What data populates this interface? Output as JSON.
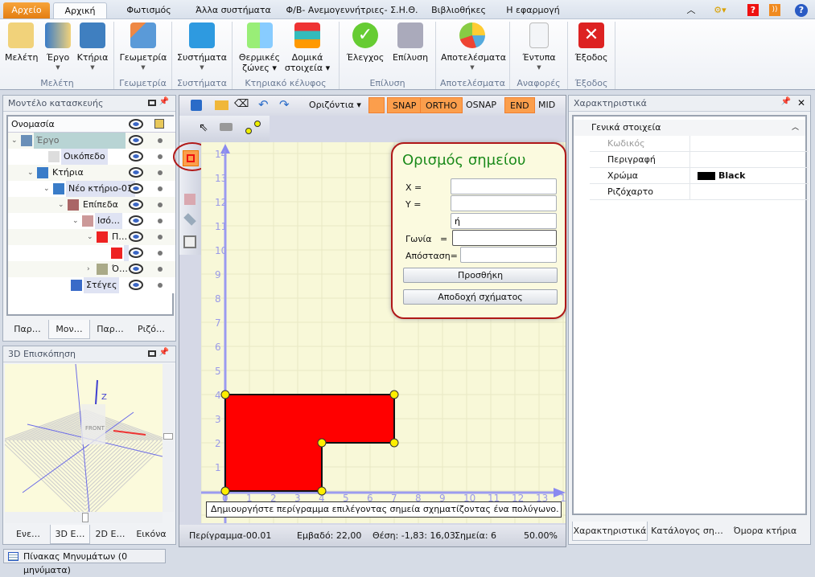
{
  "ribbon_tabs": [
    "Αρχείο",
    "Αρχική",
    "Φωτισμός",
    "Άλλα συστήματα",
    "Φ/Β- Ανεμογεννήτριες- Σ.Η.Θ.",
    "Βιβλιοθήκες",
    "Η εφαρμογή"
  ],
  "ribbon": {
    "buttons": [
      "Μελέτη",
      "Έργο",
      "Κτήρια",
      "Γεωμετρία",
      "Συστήματα",
      "Θερμικές",
      "ζώνες",
      "Δομικά",
      "στοιχεία",
      "Έλεγχος",
      "Επίλυση",
      "Αποτελέσματα",
      "Έντυπα",
      "Έξοδος"
    ],
    "groups": [
      "Μελέτη",
      "Γεωμετρία",
      "Συστήματα",
      "Κτηριακό κέλυφος",
      "Επίλυση",
      "Αποτελέσματα",
      "Αναφορές",
      "Έξοδος"
    ]
  },
  "model_panel": {
    "title": "Μοντέλο κατασκευής",
    "header": "Ονομασία",
    "items": [
      "Έργο",
      "Οικόπεδο",
      "Κτήρια",
      "Νέο κτήριο-01",
      "Επίπεδα",
      "Ισό…",
      "Π…",
      "",
      "Ό…",
      "Στέγες"
    ],
    "tabs": [
      "Παρ…",
      "Μον…",
      "Παρ…",
      "Ριζό…"
    ]
  },
  "preview_panel": {
    "title": "3D Επισκόπηση",
    "axis_label": "Z",
    "cube_label": "FRONT",
    "tabs": [
      "Ενε…",
      "3D Ε…",
      "2D Ε…",
      "Εικόνα"
    ]
  },
  "toolbar": {
    "view_select": "Οριζόντια",
    "snap": "SNAP",
    "ortho": "ORTHO",
    "osnap": "OSNAP",
    "end": "END",
    "mid": "MID"
  },
  "point_form": {
    "title": "Ορισμός σημείου",
    "x_label": "X =",
    "y_label": "Y =",
    "or_value": "ή",
    "angle_label": "Γωνία   =",
    "distance_label": "Απόσταση=",
    "add_button": "Προσθήκη",
    "accept_button": "Αποδοχή σχήματος"
  },
  "canvas": {
    "hint": "Δημιουργήστε περίγραμμα επιλέγοντας σημεία σχηματίζοντας ένα πολύγωνο. Επιλέξτε το",
    "x_ticks": [
      "1",
      "0",
      "1",
      "2",
      "3",
      "4",
      "5",
      "6",
      "7",
      "8",
      "9",
      "10",
      "11",
      "12",
      "13",
      "14"
    ],
    "y_ticks": [
      "1",
      "2",
      "3",
      "4",
      "5",
      "6",
      "7",
      "8",
      "9",
      "10",
      "11",
      "12",
      "13",
      "14"
    ],
    "polygon": [
      [
        0,
        0
      ],
      [
        0,
        4
      ],
      [
        7,
        4
      ],
      [
        7,
        2
      ],
      [
        4,
        2
      ],
      [
        4,
        0
      ]
    ],
    "fill_color": "#ff0000",
    "grid_color": "#f8f8d8"
  },
  "status": {
    "name": "Περίγραμμα-00.01",
    "area": "Εμβαδό: 22,00",
    "position": "Θέση: -1,83: 16,03",
    "points": "Σημεία: 6",
    "zoom": "50.00%"
  },
  "properties": {
    "title": "Χαρακτηριστικά",
    "section": "Γενικά στοιχεία",
    "rows": [
      {
        "label": "Κωδικός",
        "value": ""
      },
      {
        "label": "Περιγραφή",
        "value": ""
      },
      {
        "label": "Χρώμα",
        "value": "Black"
      },
      {
        "label": "Ριζόχαρτο",
        "value": ""
      }
    ],
    "tabs": [
      "Χαρακτηριστικά",
      "Κατάλογος ση…",
      "Όμορα κτήρια"
    ]
  },
  "messages": "Πίνακας Μηνυμάτων (0 μηνύματα)"
}
